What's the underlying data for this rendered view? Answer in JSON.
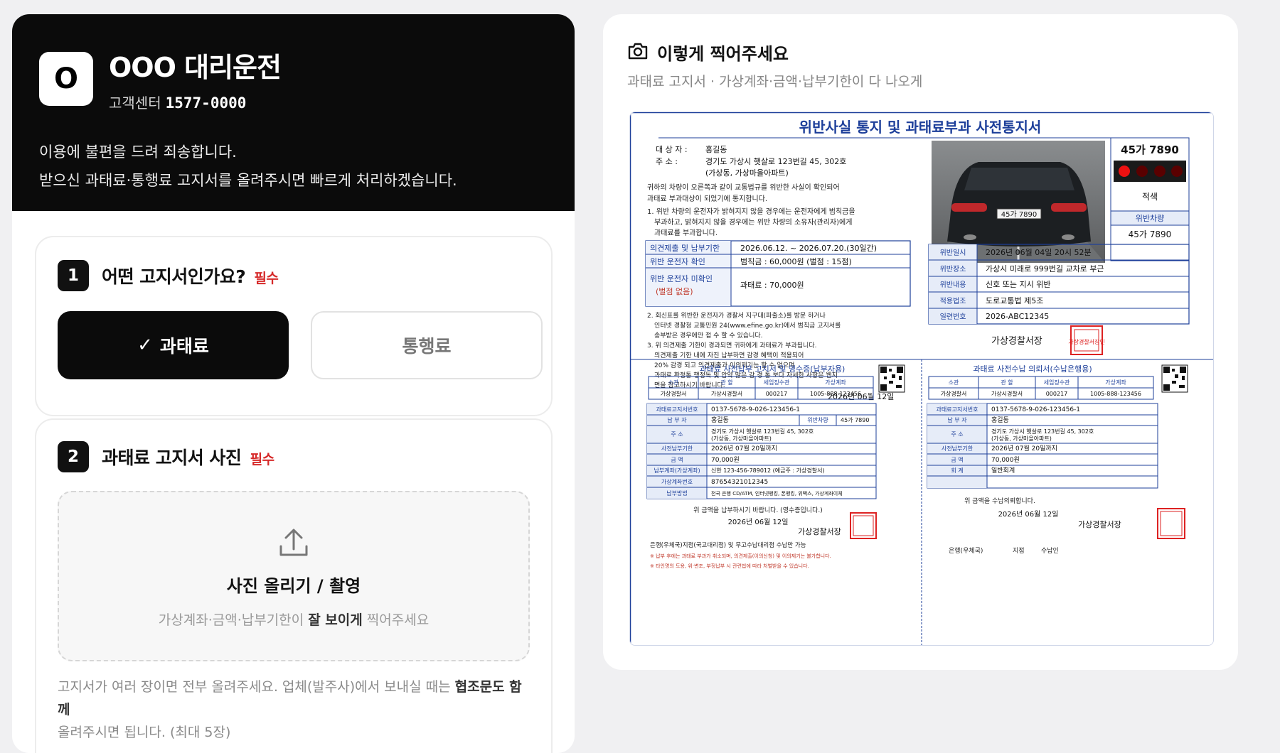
{
  "company": {
    "logo": "O",
    "name": "OOO 대리운전",
    "cs_label": "고객센터",
    "cs_phone": "1577-0000"
  },
  "notice": [
    "이용에 불편을 드려 죄송합니다.",
    "받으신 과태료·통행료 고지서를 올려주시면 빠르게 처리하겠습니다."
  ],
  "q1": {
    "num": "1",
    "title": "어떤 고지서인가요?",
    "required": "필수",
    "options": [
      "과태료",
      "통행료"
    ],
    "selected": "과태료"
  },
  "q2": {
    "num": "2",
    "title": "과태료 고지서 사진",
    "required": "필수",
    "upload_title": "사진 올리기 / 촬영",
    "hint_pre": "가상계좌·금액·납부기한이",
    "hint_bold": "잘 보이게",
    "hint_post": "찍어주세요",
    "foot_pre": "고지서가 여러 장이면 전부 올려주세요. 업체(발주사)에서 보내실 때는",
    "foot_bold": "협조문도 함께",
    "foot_post": "올려주시면 됩니다. (최대 5장)"
  },
  "guide": {
    "title": "이렇게 찍어주세요",
    "subtitle": "과태료 고지서 · 가상계좌·금액·납부기한이 다 나오게"
  },
  "doc": {
    "title": "위반사실 통지 및 과태료부과 사전통지서",
    "target_label": "대 상 자 :",
    "target": "홍길동",
    "addr_label": "주      소 :",
    "addr1": "경기도 가상시 햇살로 123번길 45, 302호",
    "addr2": "(가상동, 가상마을아파트)",
    "intro1": "귀하의 차량이 오른쪽과 같이 교통법규를 위반한 사실이 확인되어",
    "intro2": "과태료 부과대상이 되었기에 통지합니다.",
    "n1a": "1. 위반 차량의 운전자가 밝혀지지 않을 경우에는 운전자에게 범칙금을",
    "n1b": "부과하고, 밝혀지지 않을 경우에는 위반 차량의 소유자(관리자)에게",
    "n1c": "과태료를 부과합니다.",
    "opinion_label": "의견제출 및 납부기한",
    "opinion": "2026.06.12. ~ 2026.07.20.(30일간)",
    "confirm_label": "위반 운전자 확인",
    "confirm": "범칙금 : 60,000원 (벌점 : 15점)",
    "unconfirm_label": "위반 운전자 미확인",
    "unconfirm_sub": "(벌점 없음)",
    "unconfirm": "과태료 : 70,000원",
    "n2a": "2. 회신표를 위반한 운전자가 경찰서 지구대(파출소)를 방문 하거나",
    "n2b": "인터넷 경찰청 교통민원 24(www.efine.go.kr)에서 범칙금 고지서를",
    "n2c": "송부받은 경우에만 접 수 할 수 있습니다.",
    "n3a": "3. 위 의견제출 기한이 경과되면 귀하에게 과태료가 부과됩니다.",
    "n3b": "의견제출 기한 내에 자진 납부하면 감경 혜택이 적용되어",
    "n3c": "20% 감경 되고 의견제출과 이의제기는 할 수 없으며",
    "n3d": "과태료 확정통 행정독 및 압약 많은 감 경 통 보다 자세한 사항은 웹지",
    "n3e": "면을 참고하시기 바랍니다.",
    "date": "2026년 06월 12일",
    "plate": "45가 7890",
    "color": "적색",
    "vehicle_label": "위반차량",
    "vehicle": "45가 7890",
    "car_plate": "45가 7890",
    "info": [
      [
        "위반일시",
        "2026년 06월 04일 20시 52분"
      ],
      [
        "위반장소",
        "가상시 미래로 999번길 교차로 부근"
      ],
      [
        "위반내용",
        "신호 또는 지시 위반"
      ],
      [
        "적용법조",
        "도로교통법 제5조"
      ],
      [
        "일련번호",
        "2026-ABC12345"
      ]
    ],
    "chief": "가상경찰서장",
    "seal": "가상경찰서장인",
    "b1_title": "과태료 사전납부 고지서 및 영수증(납부자용)",
    "b2_title": "과태료 사전수납 의뢰서(수납은행용)",
    "hdr": [
      "소관",
      "관 할",
      "세입징수관",
      "가상계좌"
    ],
    "hdr_vals": [
      "가상경찰서",
      "가상시경찰서",
      "000217",
      "1005-888-123456"
    ],
    "l_rows": [
      [
        "과태료고지서번호",
        "0137-5678-9-026-123456-1"
      ],
      [
        "납 부 자",
        "홍길동"
      ],
      [
        "주 소",
        "경기도 가상시 햇살로 123번길 45, 302호"
      ],
      [
        "사전납부기한",
        "2026년 07월 20일까지"
      ],
      [
        "금 액",
        "70,000원"
      ],
      [
        "납부계좌(가상계좌)",
        "신한 123-456-789012 (예금주 : 가상경찰서)"
      ],
      [
        "가상계좌번호",
        "87654321012345"
      ],
      [
        "납부방법",
        "전국 은행 CD/ATM, 인터넷뱅킹, 폰뱅킹, 위택스, 가상계좌이체"
      ]
    ],
    "vehicle_small_label": "위반차량",
    "vehicle_small": "45가 7890",
    "addr_small2": "(가상동, 가상마을아파트)",
    "r_rows": [
      [
        "과태료고지서번호",
        "0137-5678-9-026-123456-1"
      ],
      [
        "납 부 자",
        "홍길동"
      ],
      [
        "주 소",
        "경기도 가상시 햇살로 123번길 45, 302호"
      ],
      [
        "사전납부기한",
        "2026년 07월 20일까지"
      ],
      [
        "금 액",
        "70,000원"
      ],
      [
        "회 계",
        "일반회계"
      ]
    ],
    "pay_l": "위 금액을 납부하시기 바랍니다. (영수증입니다.)",
    "pay_r": "위 금액을 수납의뢰합니다.",
    "bank_l": "은행(우체국)지점(국고대리점) 및 무고수납대리점 수납만 가능",
    "warn1": "※ 납부 후에는 과태료 부과가 취소되며, 의견제출(이의신청) 및 이의제기는 불가합니다.",
    "warn2": "※ 타인명의 도용, 위·변조, 부정납부 시 관련법에 따라 처벌받을 수 있습니다.",
    "bank_r": [
      "은행(우체국)",
      "지점",
      "수납인"
    ]
  }
}
